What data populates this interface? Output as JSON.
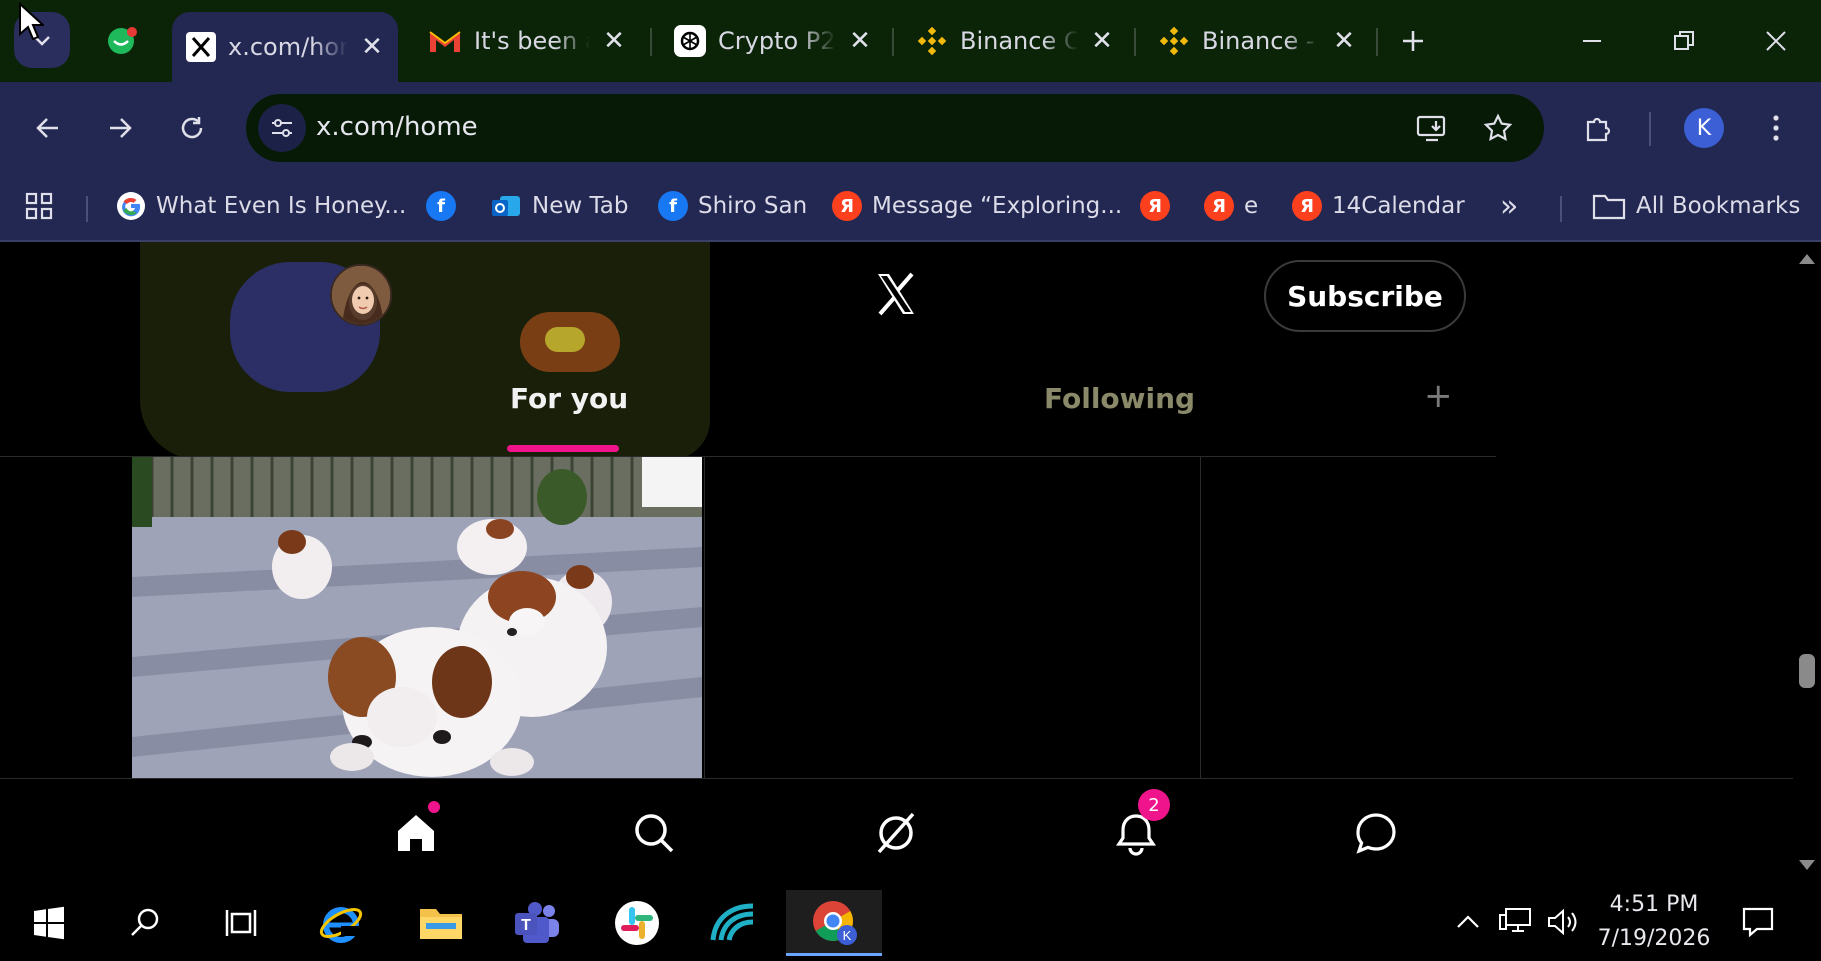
{
  "browser": {
    "tabs": [
      {
        "title": "x.com/home",
        "favicon": "x-icon",
        "active": true
      },
      {
        "title": "It's been a",
        "favicon": "gmail-icon",
        "active": false
      },
      {
        "title": "Crypto P2P",
        "favicon": "openai-icon",
        "active": false
      },
      {
        "title": "Binance C",
        "favicon": "binance-icon",
        "active": false
      },
      {
        "title": "Binance -",
        "favicon": "binance-icon",
        "active": false
      }
    ],
    "close_glyph": "✕",
    "url": "x.com/home",
    "profile_initial": "K",
    "bookmarks": [
      {
        "label": "What Even Is Honey...",
        "icon": "google-icon"
      },
      {
        "label": "",
        "icon": "facebook-icon"
      },
      {
        "label": "New Tab",
        "icon": "outlook-icon"
      },
      {
        "label": "Shiro San",
        "icon": "facebook-icon"
      },
      {
        "label": "Message “Exploring...",
        "icon": "yandex-icon"
      },
      {
        "label": "",
        "icon": "yandex-icon"
      },
      {
        "label": "e",
        "icon": "yandex-icon"
      },
      {
        "label": "14Calendar",
        "icon": "yandex-icon"
      }
    ],
    "bookmarks_overflow": "»",
    "all_bookmarks": "All Bookmarks"
  },
  "x_app": {
    "subscribe_label": "Subscribe",
    "tabs": [
      {
        "label": "For you",
        "active": true
      },
      {
        "label": "Following",
        "active": false
      }
    ],
    "add_tab": "+",
    "notifications_badge": "2",
    "accent": "#f0148c"
  },
  "taskbar": {
    "time": "4:51 PM",
    "date": "7/19/2026"
  }
}
